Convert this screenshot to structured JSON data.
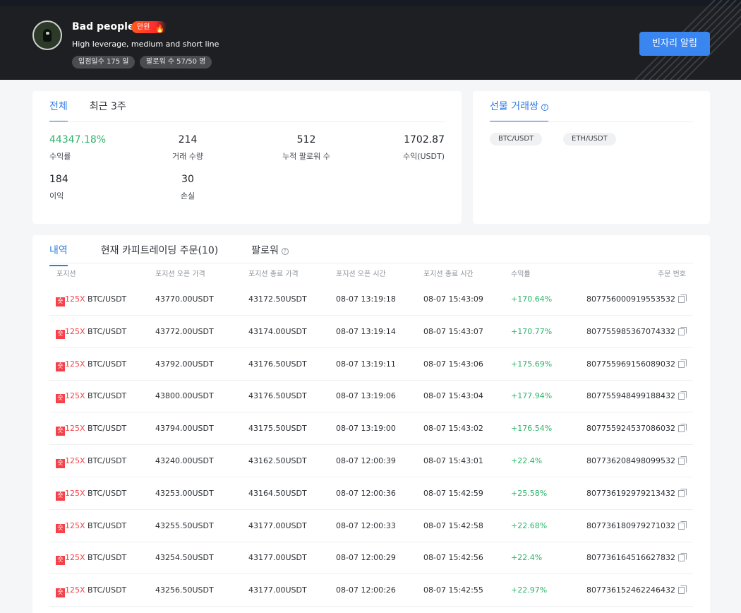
{
  "header": {
    "name": "Bad people",
    "badge": "만원",
    "description": "High leverage, medium and short line",
    "chips": [
      "입점일수 175 일",
      "팔로워 수 57/50 명"
    ],
    "alert_button": "빈자리 알림"
  },
  "stats": {
    "tabs": [
      "전체",
      "최근 3주"
    ],
    "items": [
      {
        "value": "44347.18%",
        "label": "수익률"
      },
      {
        "value": "214",
        "label": "거래 수량"
      },
      {
        "value": "512",
        "label": "누적 팔로워 수"
      },
      {
        "value": "1702.87",
        "label": "수익(USDT)"
      },
      {
        "value": "184",
        "label": "이익"
      },
      {
        "value": "30",
        "label": "손실"
      }
    ]
  },
  "pairs": {
    "title": "선물 거래쌍",
    "items": [
      "BTC/USDT",
      "ETH/USDT"
    ]
  },
  "history": {
    "tabs": [
      "내역",
      "현재 카피트레이딩 주문(10)",
      "팔로워"
    ],
    "columns": [
      "포지션",
      "포지션 오픈 가격",
      "포지션 종료 가격",
      "포지션 오픈 시간",
      "포지션 종료 시간",
      "수익률",
      "주문 번호"
    ],
    "rows": [
      {
        "side": "숏",
        "leverage": "125X",
        "pair": "BTC/USDT",
        "open_price": "43770.00USDT",
        "close_price": "43172.50USDT",
        "open_time": "08-07 13:19:18",
        "close_time": "08-07 15:43:09",
        "pnl": "+170.64%",
        "order": "807756000919553532"
      },
      {
        "side": "숏",
        "leverage": "125X",
        "pair": "BTC/USDT",
        "open_price": "43772.00USDT",
        "close_price": "43174.00USDT",
        "open_time": "08-07 13:19:14",
        "close_time": "08-07 15:43:07",
        "pnl": "+170.77%",
        "order": "807755985367074332"
      },
      {
        "side": "숏",
        "leverage": "125X",
        "pair": "BTC/USDT",
        "open_price": "43792.00USDT",
        "close_price": "43176.50USDT",
        "open_time": "08-07 13:19:11",
        "close_time": "08-07 15:43:06",
        "pnl": "+175.69%",
        "order": "807755969156089032"
      },
      {
        "side": "숏",
        "leverage": "125X",
        "pair": "BTC/USDT",
        "open_price": "43800.00USDT",
        "close_price": "43176.50USDT",
        "open_time": "08-07 13:19:06",
        "close_time": "08-07 15:43:04",
        "pnl": "+177.94%",
        "order": "807755948499188432"
      },
      {
        "side": "숏",
        "leverage": "125X",
        "pair": "BTC/USDT",
        "open_price": "43794.00USDT",
        "close_price": "43175.50USDT",
        "open_time": "08-07 13:19:00",
        "close_time": "08-07 15:43:02",
        "pnl": "+176.54%",
        "order": "807755924537086032"
      },
      {
        "side": "숏",
        "leverage": "125X",
        "pair": "BTC/USDT",
        "open_price": "43240.00USDT",
        "close_price": "43162.50USDT",
        "open_time": "08-07 12:00:39",
        "close_time": "08-07 15:43:01",
        "pnl": "+22.4%",
        "order": "807736208498099532"
      },
      {
        "side": "숏",
        "leverage": "125X",
        "pair": "BTC/USDT",
        "open_price": "43253.00USDT",
        "close_price": "43164.50USDT",
        "open_time": "08-07 12:00:36",
        "close_time": "08-07 15:42:59",
        "pnl": "+25.58%",
        "order": "807736192979213432"
      },
      {
        "side": "숏",
        "leverage": "125X",
        "pair": "BTC/USDT",
        "open_price": "43255.50USDT",
        "close_price": "43177.00USDT",
        "open_time": "08-07 12:00:33",
        "close_time": "08-07 15:42:58",
        "pnl": "+22.68%",
        "order": "807736180979271032"
      },
      {
        "side": "숏",
        "leverage": "125X",
        "pair": "BTC/USDT",
        "open_price": "43254.50USDT",
        "close_price": "43177.00USDT",
        "open_time": "08-07 12:00:29",
        "close_time": "08-07 15:42:56",
        "pnl": "+22.4%",
        "order": "807736164516627832"
      },
      {
        "side": "숏",
        "leverage": "125X",
        "pair": "BTC/USDT",
        "open_price": "43256.50USDT",
        "close_price": "43177.00USDT",
        "open_time": "08-07 12:00:26",
        "close_time": "08-07 15:42:55",
        "pnl": "+22.97%",
        "order": "807736152462246432"
      }
    ]
  }
}
